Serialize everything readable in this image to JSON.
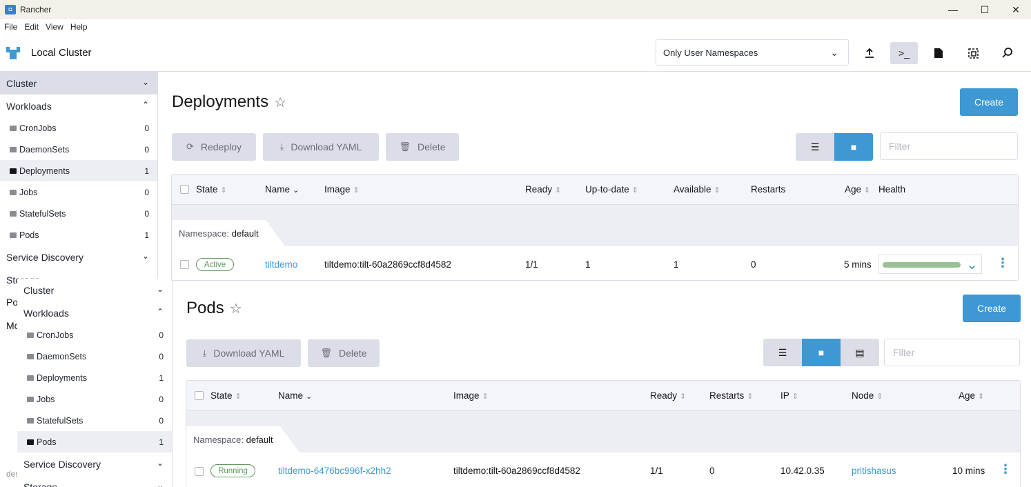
{
  "window": {
    "title": "Rancher",
    "controls": [
      "—",
      "☐",
      "✕"
    ]
  },
  "menu": [
    "File",
    "Edit",
    "View",
    "Help"
  ],
  "header": {
    "cluster_name": "Local Cluster",
    "namespace_select": "Only User Namespaces",
    "buttons": [
      "import-yaml",
      "kubectl-shell",
      "kubeconfig",
      "resource-search",
      "search"
    ]
  },
  "nav": {
    "cluster": "Cluster",
    "workloads": "Workloads",
    "items": [
      {
        "label": "CronJobs",
        "count": "0"
      },
      {
        "label": "DaemonSets",
        "count": "0"
      },
      {
        "label": "Deployments",
        "count": "1"
      },
      {
        "label": "Jobs",
        "count": "0"
      },
      {
        "label": "StatefulSets",
        "count": "0"
      },
      {
        "label": "Pods",
        "count": "1"
      }
    ],
    "service_discovery": "Service Discovery",
    "storage": "Storage",
    "ghost_pol": "Pol",
    "ghost_mo": "Mo",
    "ghost_des": "des"
  },
  "nav2": {
    "cluster": "Cluster",
    "workloads": "Workloads",
    "items": [
      {
        "label": "CronJobs",
        "count": "0"
      },
      {
        "label": "DaemonSets",
        "count": "0"
      },
      {
        "label": "Deployments",
        "count": "1"
      },
      {
        "label": "Jobs",
        "count": "0"
      },
      {
        "label": "StatefulSets",
        "count": "0"
      },
      {
        "label": "Pods",
        "count": "1"
      }
    ],
    "service_discovery": "Service Discovery",
    "storage": "Storage"
  },
  "deployments": {
    "title": "Deployments",
    "create": "Create",
    "redeploy": "Redeploy",
    "download_yaml": "Download YAML",
    "delete": "Delete",
    "filter_placeholder": "Filter",
    "columns": [
      "State",
      "Name",
      "Image",
      "Ready",
      "Up-to-date",
      "Available",
      "Restarts",
      "Age",
      "Health"
    ],
    "namespace_label": "Namespace:",
    "namespace_value": "default",
    "row": {
      "state": "Active",
      "name": "tiltdemo",
      "image": "tiltdemo:tilt-60a2869ccf8d4582",
      "ready": "1/1",
      "up_to_date": "1",
      "available": "1",
      "restarts": "0",
      "age": "5 mins",
      "health": 1.0
    }
  },
  "pods": {
    "title": "Pods",
    "create": "Create",
    "download_yaml": "Download YAML",
    "delete": "Delete",
    "filter_placeholder": "Filter",
    "columns": [
      "State",
      "Name",
      "Image",
      "Ready",
      "Restarts",
      "IP",
      "Node",
      "Age"
    ],
    "namespace_label": "Namespace:",
    "namespace_value": "default",
    "row": {
      "state": "Running",
      "name": "tiltdemo-6476bc996f-x2hh2",
      "image": "tiltdemo:tilt-60a2869ccf8d4582",
      "ready": "1/1",
      "restarts": "0",
      "ip": "10.42.0.35",
      "node": "pritishasus",
      "age": "10 mins"
    }
  },
  "colors": {
    "primary": "#3d98d3",
    "active_green": "#5d995d",
    "border": "#dcdee7"
  }
}
